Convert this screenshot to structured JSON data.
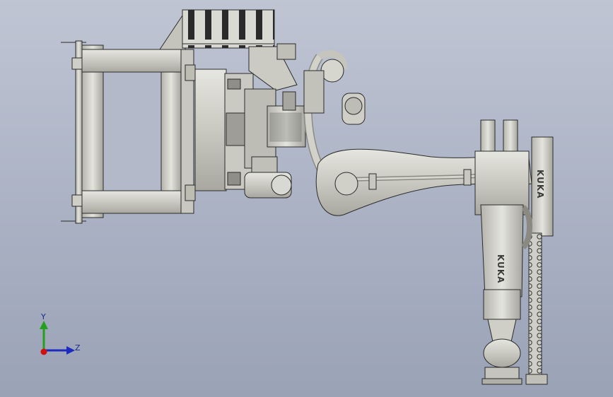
{
  "viewport": {
    "background_top": "#bfc5d3",
    "background_bottom": "#9aa2b6",
    "part_fill": "#d4d4cc",
    "part_edge": "#2a2a2a",
    "axis_y_color": "#22a01e",
    "axis_z_color": "#1c2ac0",
    "axis_x_color": "#d01010"
  },
  "robot": {
    "brand_arm": "KUKA",
    "brand_lower": "KUKA"
  },
  "triad": {
    "y_label": "Y",
    "z_label": "Z"
  }
}
